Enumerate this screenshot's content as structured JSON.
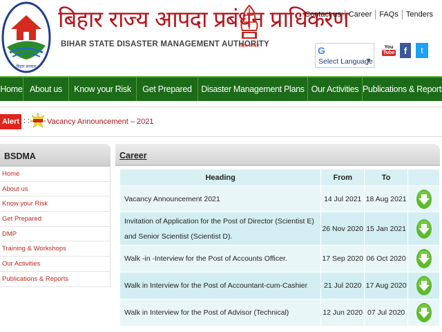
{
  "header": {
    "hindi_title": "बिहार राज्य आपदा प्रबंधन प्राधिकरण",
    "english_title": "BIHAR STATE DISASTER MANAGEMENT AUTHORITY",
    "logo_caption": "बिहार सरकार",
    "emblem_caption": "बिहार सरकार",
    "top_links": [
      "Contact us",
      "Career",
      "FAQs",
      "Tenders"
    ],
    "language_selector": "Select Language",
    "youtube_label_top": "You",
    "youtube_label_bottom": "Tube",
    "facebook_label": "f",
    "twitter_label": "t"
  },
  "nav": {
    "items": [
      "Home",
      "About us",
      "Know your Risk",
      "Get Prepared",
      "Disaster Management Plans",
      "Our Activities",
      "Publications & Reports"
    ]
  },
  "alert": {
    "label": "Alert",
    "separator": ": :-",
    "text": "Vacancy Announcement – 2021"
  },
  "sidebar": {
    "title": "BSDMA",
    "items": [
      "Home",
      "About us",
      "Know your Risk",
      "Get Prepared",
      "DMP",
      "Training & Workshops",
      "Our Activities",
      "Publications & Reports"
    ]
  },
  "main": {
    "title": "Career",
    "columns": [
      "Heading",
      "From",
      "To",
      ""
    ],
    "rows": [
      {
        "heading": "Vacancy Announcement 2021",
        "from": "14 Jul 2021",
        "to": "18 Aug 2021"
      },
      {
        "heading": "Invitation of Application for the Post of Director (Scientist E) and Senior Scientist (Scientist D).",
        "from": "26 Nov 2020",
        "to": "15 Jan 2021"
      },
      {
        "heading": "Walk -in -Interview for the Post of Accounts Officer.",
        "from": "17 Sep 2020",
        "to": "06 Oct 2020"
      },
      {
        "heading": "Walk in Interview for the Post of Accountant-cum-Cashier",
        "from": "21 Jul 2020",
        "to": "17 Aug 2020"
      },
      {
        "heading": "Walk in Interview for the Post of Advisor (Technical)",
        "from": "12 Jun 2020",
        "to": "07 Jul 2020"
      }
    ]
  },
  "colors": {
    "nav_bg": "#1c6b18",
    "title_red": "#b8141b",
    "alert_red": "#e0231d",
    "table_header": "#d8f0f3",
    "download_green": "#5dbb2b"
  }
}
